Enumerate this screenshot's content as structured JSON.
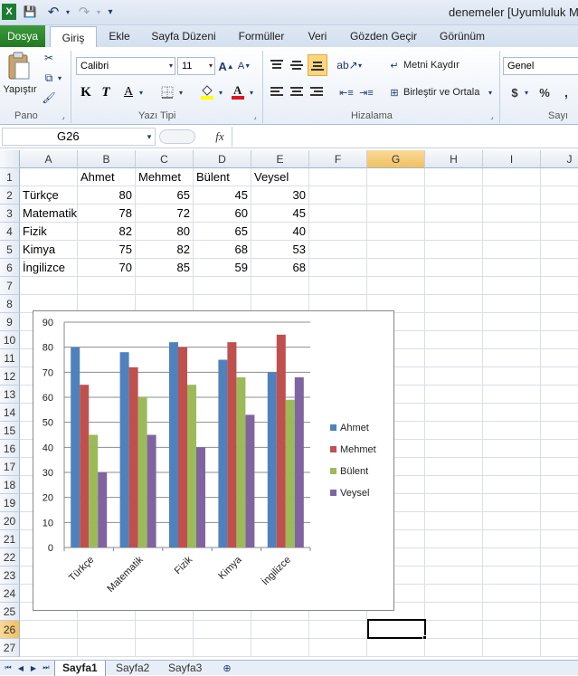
{
  "window": {
    "title": "denemeler  [Uyumluluk M"
  },
  "quick_access": {
    "undo_label": "↶",
    "redo_label": "↷"
  },
  "tabs": [
    "Dosya",
    "Giriş",
    "Ekle",
    "Sayfa Düzeni",
    "Formüller",
    "Veri",
    "Gözden Geçir",
    "Görünüm"
  ],
  "ribbon": {
    "clipboard": {
      "paste_label": "Yapıştır",
      "group_label": "Pano"
    },
    "font": {
      "font_name": "Calibri",
      "font_size": "11",
      "bold": "K",
      "italic": "T",
      "underline": "A",
      "group_label": "Yazı Tipi"
    },
    "alignment": {
      "wrap_text": "Metni Kaydır",
      "merge_center": "Birleştir ve Ortala",
      "group_label": "Hizalama"
    },
    "number": {
      "format": "Genel",
      "currency": "$",
      "percent": "%",
      "comma": ",",
      "group_label": "Sayı"
    }
  },
  "formula_bar": {
    "name_box": "G26",
    "fx": "fx",
    "formula": ""
  },
  "columns": [
    "A",
    "B",
    "C",
    "D",
    "E",
    "F",
    "G",
    "H",
    "I",
    "J"
  ],
  "selected_column": "G",
  "selected_row": 26,
  "rows": [
    1,
    2,
    3,
    4,
    5,
    6,
    7,
    8,
    9,
    10,
    11,
    12,
    13,
    14,
    15,
    16,
    17,
    18,
    19,
    20,
    21,
    22,
    23,
    24,
    25,
    26,
    27
  ],
  "table": {
    "header": [
      "",
      "Ahmet",
      "Mehmet",
      "Bülent",
      "Veysel"
    ],
    "rows": [
      [
        "Türkçe",
        "80",
        "65",
        "45",
        "30"
      ],
      [
        "Matematik",
        "78",
        "72",
        "60",
        "45"
      ],
      [
        "Fizik",
        "82",
        "80",
        "65",
        "40"
      ],
      [
        "Kimya",
        "75",
        "82",
        "68",
        "53"
      ],
      [
        "İngilizce",
        "70",
        "85",
        "59",
        "68"
      ]
    ]
  },
  "chart_data": {
    "type": "bar",
    "categories": [
      "Türkçe",
      "Matematik",
      "Fizik",
      "Kimya",
      "İngilizce"
    ],
    "series": [
      {
        "name": "Ahmet",
        "values": [
          80,
          78,
          82,
          75,
          70
        ],
        "color": "#4f81bd"
      },
      {
        "name": "Mehmet",
        "values": [
          65,
          72,
          80,
          82,
          85
        ],
        "color": "#c0504d"
      },
      {
        "name": "Bülent",
        "values": [
          45,
          60,
          65,
          68,
          59
        ],
        "color": "#9bbb59"
      },
      {
        "name": "Veysel",
        "values": [
          30,
          45,
          40,
          53,
          68
        ],
        "color": "#8064a2"
      }
    ],
    "yticks": [
      "0",
      "10",
      "20",
      "30",
      "40",
      "50",
      "60",
      "70",
      "80",
      "90"
    ],
    "ylim": [
      0,
      90
    ],
    "legend_position": "right"
  },
  "sheets": [
    "Sayfa1",
    "Sayfa2",
    "Sayfa3"
  ],
  "active_sheet": "Sayfa1"
}
